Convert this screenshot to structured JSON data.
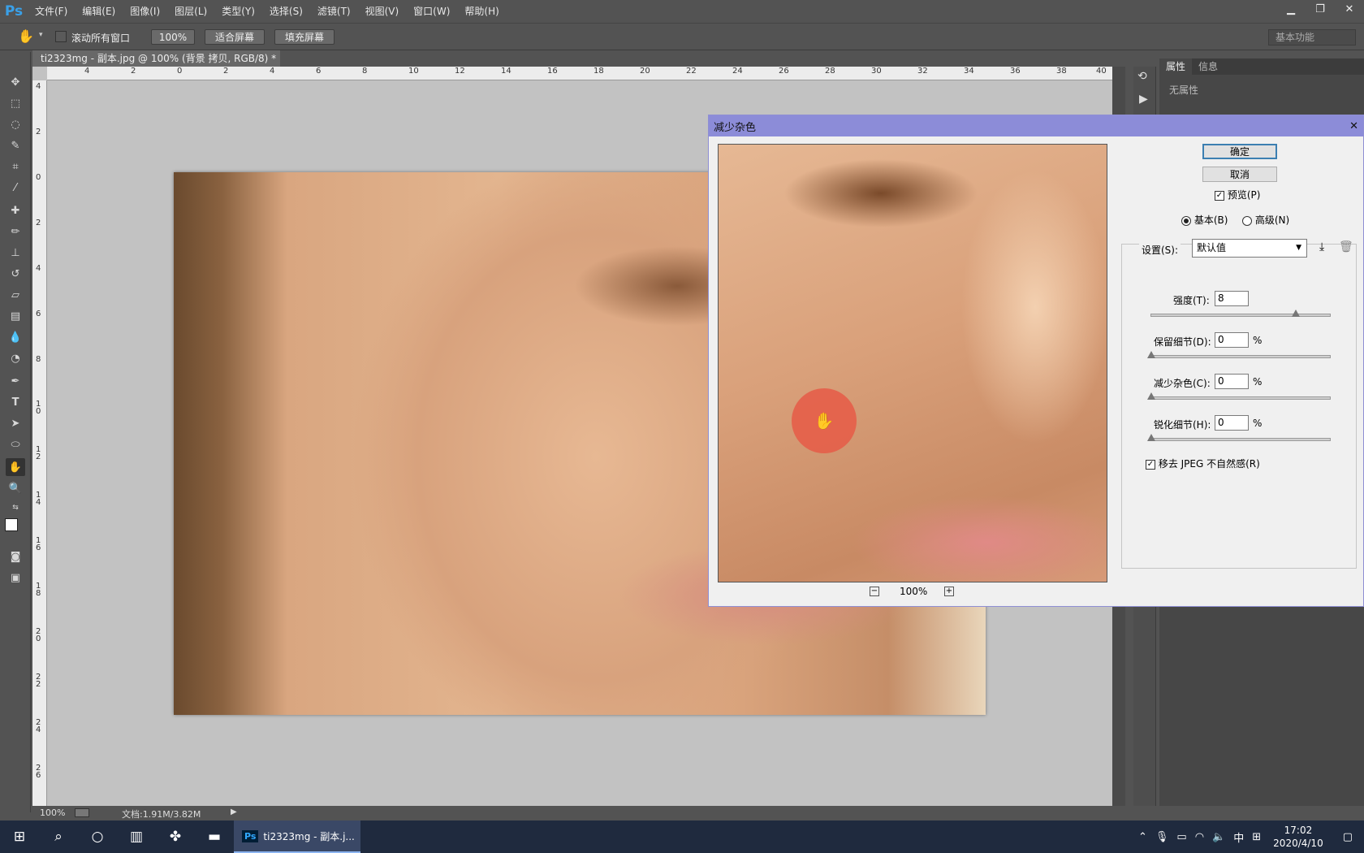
{
  "app": {
    "logo": "Ps"
  },
  "menu": [
    "文件(F)",
    "编辑(E)",
    "图像(I)",
    "图层(L)",
    "类型(Y)",
    "选择(S)",
    "滤镜(T)",
    "视图(V)",
    "窗口(W)",
    "帮助(H)"
  ],
  "options": {
    "scroll_all": "滚动所有窗口",
    "zoom_btn": "100%",
    "fit_screen": "适合屏幕",
    "fill_screen": "填充屏幕",
    "workspace": "基本功能"
  },
  "document": {
    "tab_title": "ti2323mg - 副本.jpg @ 100% (背景 拷贝, RGB/8) *",
    "tab_close": "×",
    "status_zoom": "100%",
    "status_doc": "文档:1.91M/3.82M"
  },
  "ruler": {
    "h": [
      "4",
      "2",
      "0",
      "2",
      "4",
      "6",
      "8",
      "10",
      "12",
      "14",
      "16",
      "18",
      "20",
      "22",
      "24",
      "26",
      "28",
      "30",
      "32",
      "34",
      "36",
      "38",
      "40"
    ],
    "v": [
      "4",
      "2",
      "0",
      "2",
      "4",
      "6",
      "8",
      "1 0",
      "1 2",
      "1 4",
      "1 6",
      "1 8",
      "2 0",
      "2 2",
      "2 4",
      "2 6"
    ]
  },
  "panel": {
    "tab_properties": "属性",
    "tab_info": "信息",
    "no_properties": "无属性"
  },
  "dialog": {
    "title": "减少杂色",
    "close": "✕",
    "ok": "确定",
    "cancel": "取消",
    "preview_label": "预览(P)",
    "preview_checked": true,
    "mode_basic": "基本(B)",
    "mode_advanced": "高级(N)",
    "settings_label": "设置(S):",
    "settings_value": "默认值",
    "zoom_level": "100%",
    "strength_label": "强度(T):",
    "strength_value": "8",
    "strength_level": 0.8,
    "detail_label": "保留细节(D):",
    "detail_value": "0",
    "color_label": "减少杂色(C):",
    "color_value": "0",
    "sharpen_label": "锐化细节(H):",
    "sharpen_value": "0",
    "percent": "%",
    "jpeg_label": "移去 JPEG 不自然感(R)"
  },
  "taskbar": {
    "ps_task": "ti2323mg - 副本.j...",
    "ime": "中",
    "time": "17:02",
    "date": "2020/4/10"
  }
}
